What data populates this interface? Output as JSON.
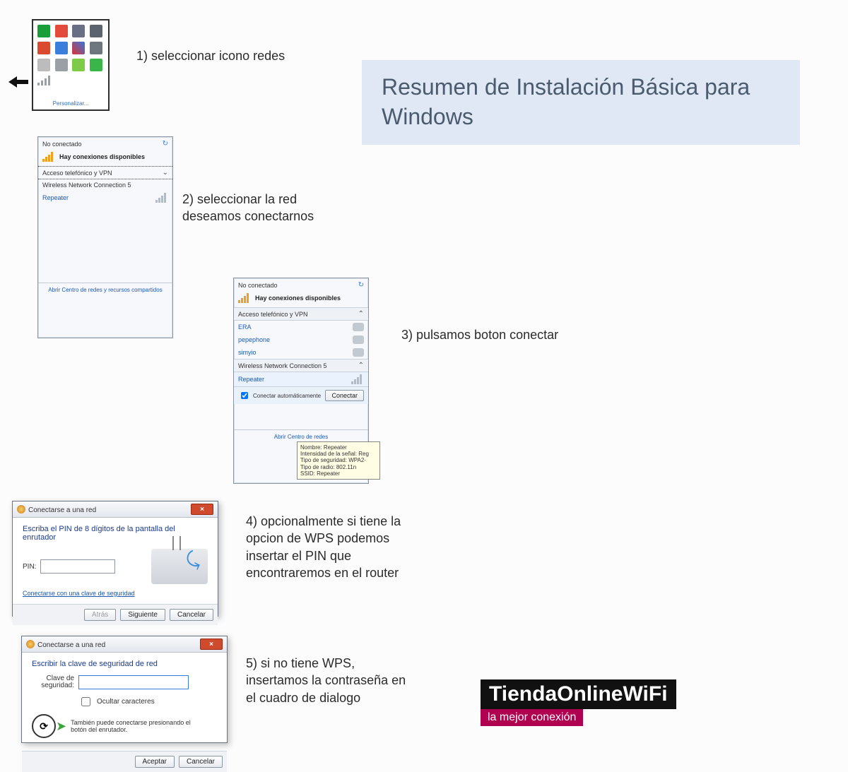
{
  "title": "Resumen de Instalación Básica para Windows",
  "steps": {
    "s1": "1) seleccionar icono redes",
    "s2": "2) seleccionar la red deseamos conectarnos",
    "s3": "3) pulsamos boton conectar",
    "s4": "4) opcionalmente si tiene la opcion de WPS podemos insertar el PIN que encontraremos en el router",
    "s5": "5) si no tiene WPS, insertamos la contraseña en el cuadro de dialogo"
  },
  "tray": {
    "customize": "Personalizar..."
  },
  "flyout": {
    "not_connected": "No conectado",
    "avail": "Hay conexiones disponibles",
    "dialup_section": "Acceso telefónico y VPN",
    "wireless_section": "Wireless Network Connection 5",
    "repeater": "Repeater",
    "open_center": "Abrir Centro de redes y recursos compartidos",
    "open_center_short": "Abrir Centro de redes",
    "vpn_items": [
      "ERA",
      "pepephone",
      "simyio"
    ],
    "auto_connect": "Conectar automáticamente",
    "connect_btn": "Conectar",
    "tooltip": {
      "l1": "Nombre: Repeater",
      "l2": "Intensidad de la señal: Reg",
      "l3": "Tipo de seguridad: WPA2-",
      "l4": "Tipo de radio: 802.11n",
      "l5": "SSID: Repeater"
    }
  },
  "dlg4": {
    "title": "Conectarse a una red",
    "instr": "Escriba el PIN de 8 dígitos de la pantalla del enrutador",
    "pin_label": "PIN:",
    "alt_link": "Conectarse con una clave de seguridad",
    "back": "Atrás",
    "next": "Siguiente",
    "cancel": "Cancelar"
  },
  "dlg5": {
    "title": "Conectarse a una red",
    "instr": "Escribir la clave de seguridad de red",
    "key_label": "Clave de seguridad:",
    "hide": "Ocultar caracteres",
    "wps_hint": "También puede conectarse presionando el botón del enrutador.",
    "ok": "Aceptar",
    "cancel": "Cancelar"
  },
  "logo": {
    "top": "TiendaOnlineWiFi",
    "bot": "la mejor conexión"
  }
}
